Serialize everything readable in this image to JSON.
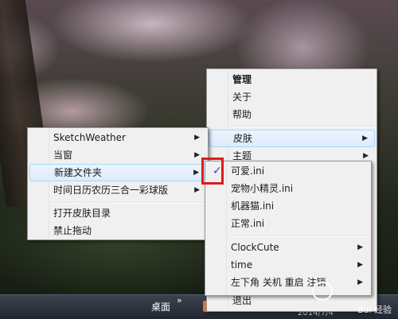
{
  "taskbar": {
    "desktop": "桌面",
    "arrows": "»",
    "clock": "2014/7/4"
  },
  "main_menu": {
    "items": [
      {
        "label": "管理"
      },
      {
        "label": "关于"
      },
      {
        "label": "帮助"
      },
      {
        "label": "皮肤"
      },
      {
        "label": "主题"
      },
      {
        "label": "退出"
      }
    ]
  },
  "left_menu": {
    "items": [
      {
        "label": "SketchWeather"
      },
      {
        "label": "当窗"
      },
      {
        "label": "新建文件夹"
      },
      {
        "label": "时间日历农历三合一彩球版"
      },
      {
        "label": "打开皮肤目录"
      },
      {
        "label": "禁止拖动"
      }
    ]
  },
  "skin_menu": {
    "checkmark": "✓",
    "items": [
      {
        "label": "可爱.ini"
      },
      {
        "label": "宠物小精灵.ini"
      },
      {
        "label": "机器猫.ini"
      },
      {
        "label": "正常.ini"
      },
      {
        "label": "ClockCute"
      },
      {
        "label": "time"
      },
      {
        "label": "左下角 关机 重启 注销"
      }
    ]
  },
  "arrow": "▶",
  "watermark": "Bai 经验"
}
